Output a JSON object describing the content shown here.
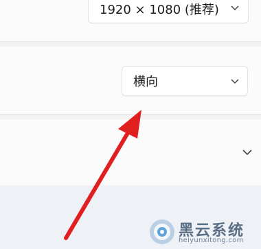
{
  "settings": {
    "resolution_dropdown": {
      "value": "1920 × 1080 (推荐)",
      "icon": "chevron-down-icon"
    },
    "orientation_dropdown": {
      "value": "横向",
      "icon": "chevron-down-icon"
    },
    "expand_row": {
      "icon": "chevron-down-icon"
    }
  },
  "annotation": {
    "arrow_color": "#e02020"
  },
  "watermark": {
    "title": "黑云系统",
    "url": "heiyunxitong.com",
    "color": "#5a6f86"
  }
}
